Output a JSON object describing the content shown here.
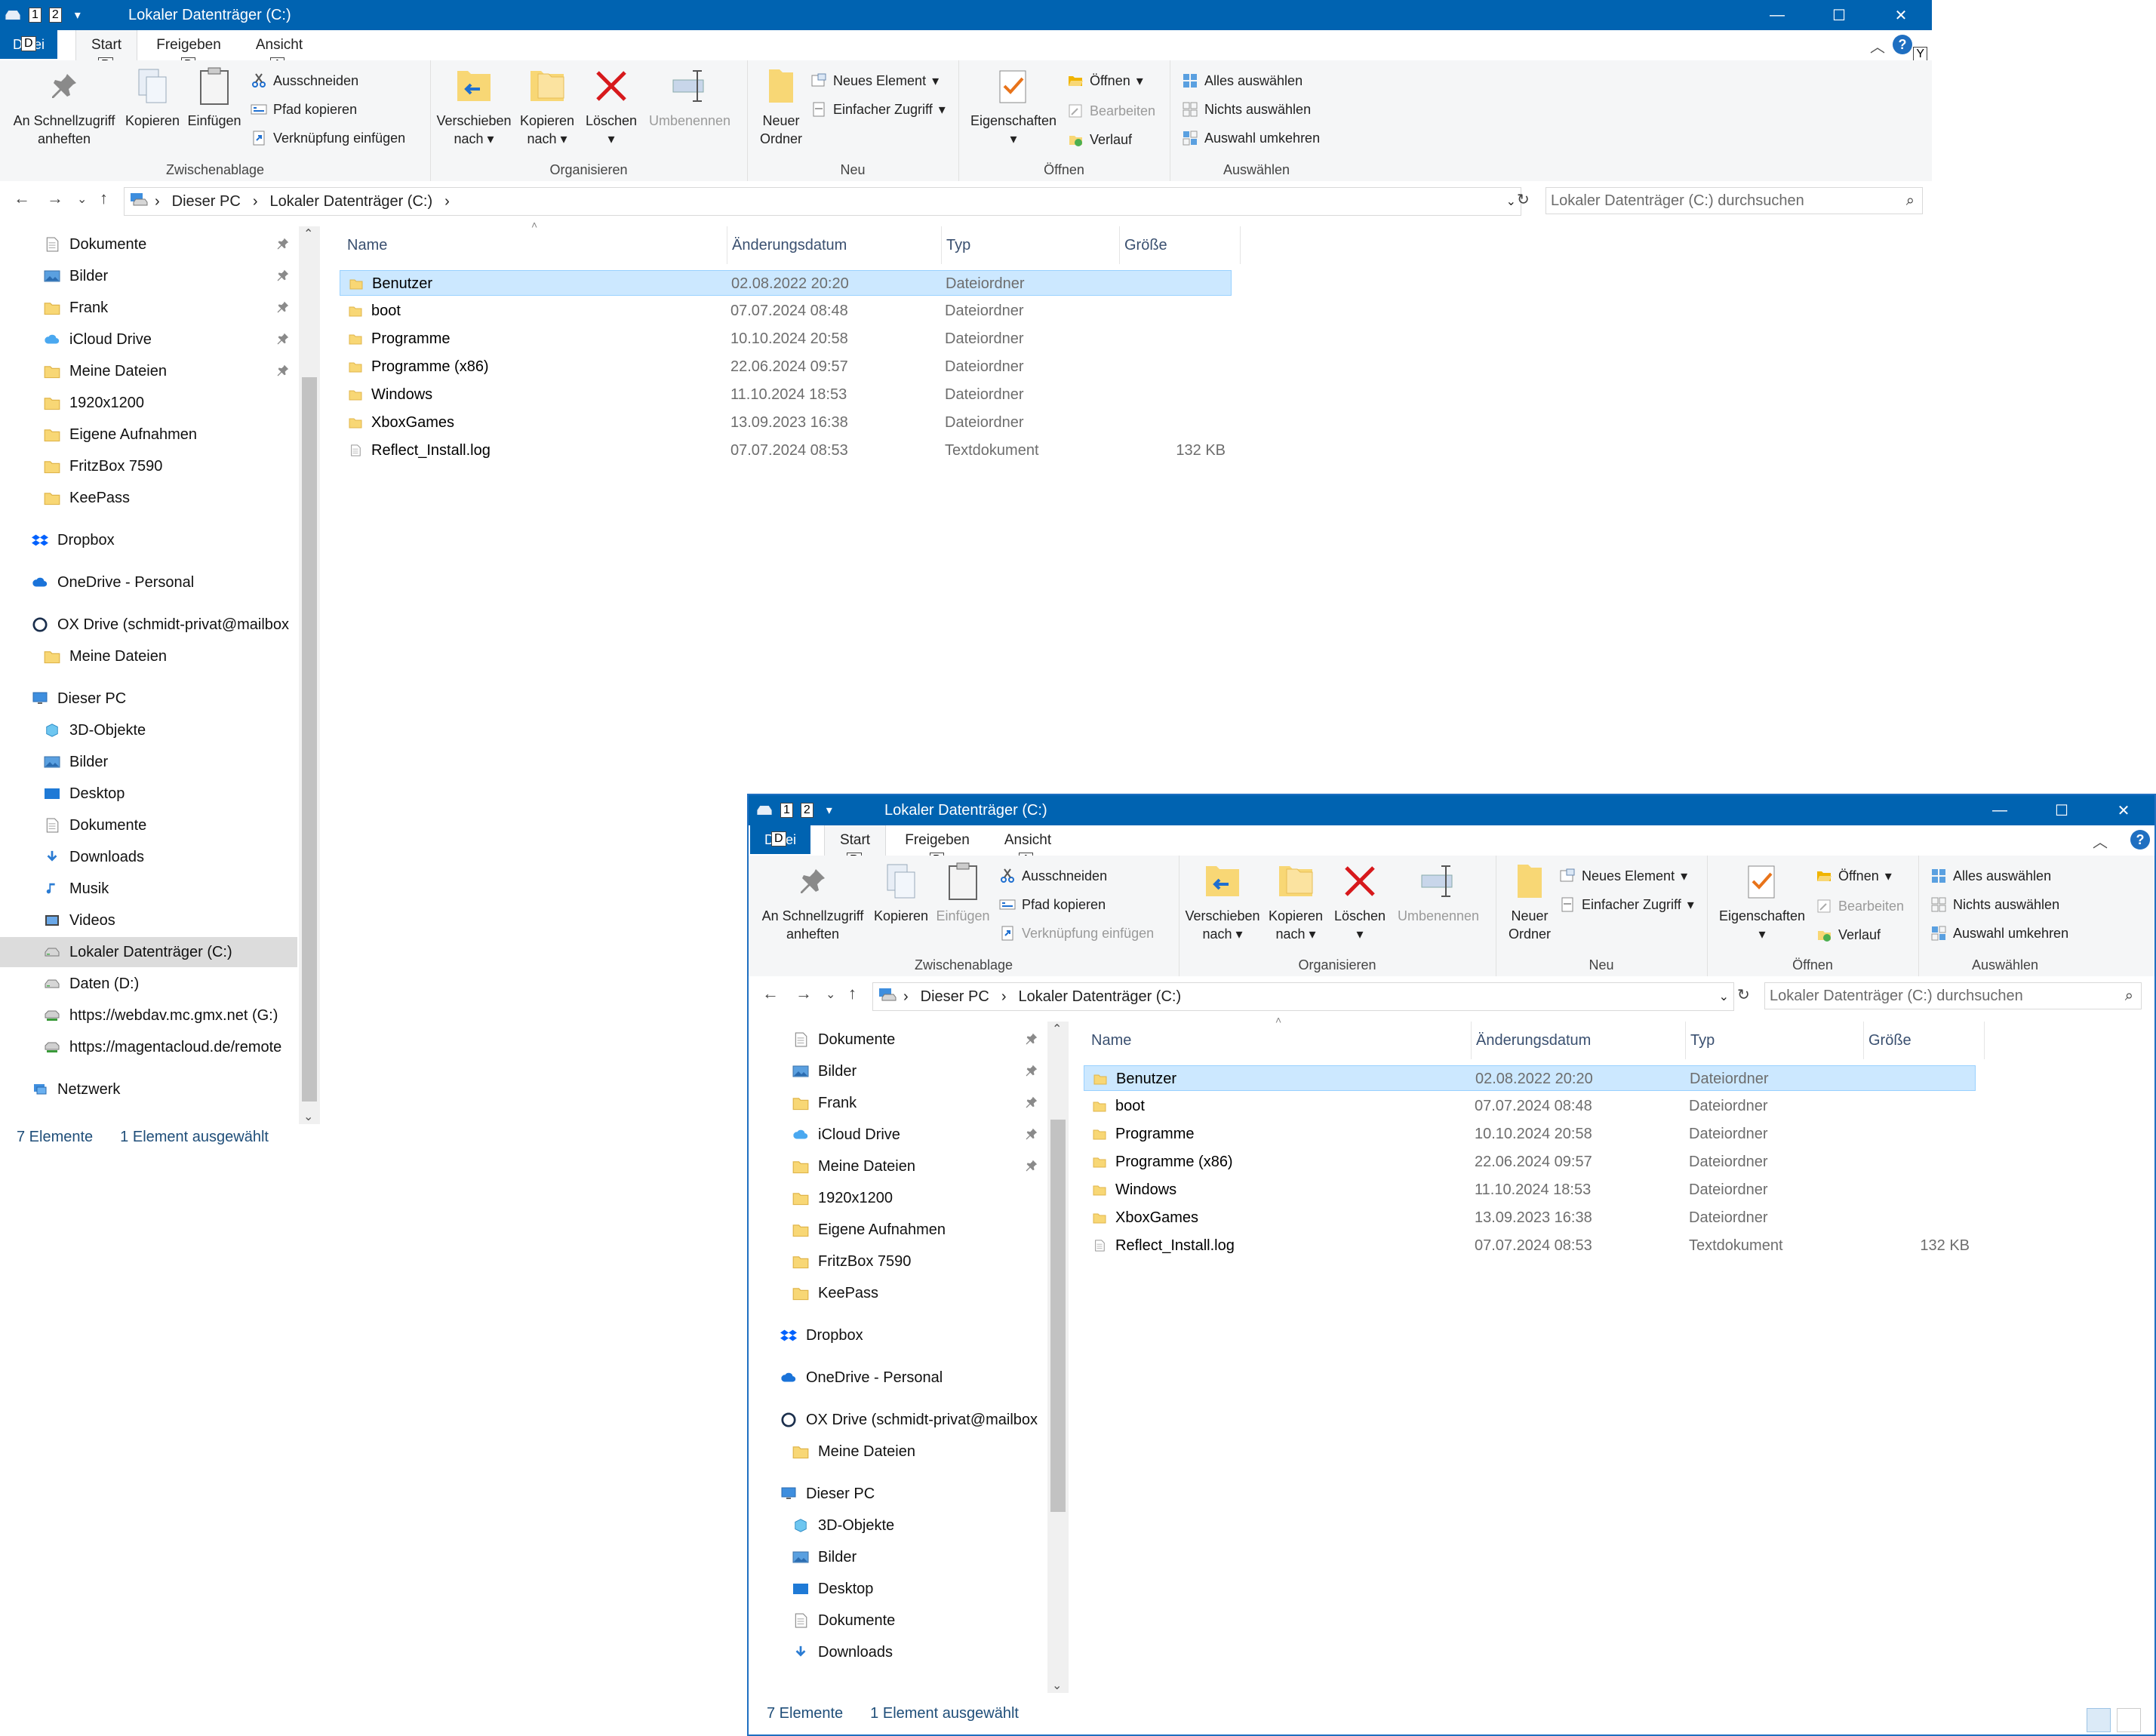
{
  "window": {
    "title": "Lokaler Datenträger (C:)",
    "qat_keytips": [
      "1",
      "2"
    ],
    "controls": {
      "minimize": "—",
      "maximize": "☐",
      "close": "✕"
    },
    "help_keytip": "Y"
  },
  "tabs": {
    "file": "Datei",
    "file_keytip": "D",
    "start": "Start",
    "start_keytip": "R",
    "share": "Freigeben",
    "share_keytip": "B",
    "view": "Ansicht",
    "view_keytip": "A"
  },
  "ribbon": {
    "clipboard": {
      "label": "Zwischenablage",
      "pin_line1": "An Schnellzugriff",
      "pin_line2": "anheften",
      "copy": "Kopieren",
      "paste": "Einfügen",
      "cut": "Ausschneiden",
      "copy_path": "Pfad kopieren",
      "paste_shortcut": "Verknüpfung einfügen"
    },
    "organize": {
      "label": "Organisieren",
      "move_line1": "Verschieben",
      "move_line2": "nach",
      "copyto_line1": "Kopieren",
      "copyto_line2": "nach",
      "delete": "Löschen",
      "rename": "Umbenennen"
    },
    "new": {
      "label": "Neu",
      "newfolder_line1": "Neuer",
      "newfolder_line2": "Ordner",
      "new_item": "Neues Element",
      "easy_access": "Einfacher Zugriff"
    },
    "open": {
      "label": "Öffnen",
      "properties": "Eigenschaften",
      "open": "Öffnen",
      "edit": "Bearbeiten",
      "history": "Verlauf"
    },
    "select": {
      "label": "Auswählen",
      "select_all": "Alles auswählen",
      "select_none": "Nichts auswählen",
      "invert": "Auswahl umkehren"
    }
  },
  "address": {
    "crumb1": "Dieser PC",
    "crumb2": "Lokaler Datenträger (C:)",
    "search_placeholder": "Lokaler Datenträger (C:) durchsuchen"
  },
  "nav": {
    "quick": [
      {
        "label": "Dokumente",
        "pinned": true
      },
      {
        "label": "Bilder",
        "pinned": true
      },
      {
        "label": "Frank",
        "pinned": true
      },
      {
        "label": "iCloud Drive",
        "pinned": true
      },
      {
        "label": "Meine Dateien",
        "pinned": true
      },
      {
        "label": "1920x1200",
        "pinned": false
      },
      {
        "label": "Eigene Aufnahmen",
        "pinned": false
      },
      {
        "label": "FritzBox 7590",
        "pinned": false
      },
      {
        "label": "KeePass",
        "pinned": false
      }
    ],
    "dropbox": "Dropbox",
    "onedrive": "OneDrive - Personal",
    "oxdrive": "OX Drive (schmidt-privat@mailbox",
    "oxdrive_child": "Meine Dateien",
    "thispc": "Dieser PC",
    "pc_children": [
      "3D-Objekte",
      "Bilder",
      "Desktop",
      "Dokumente",
      "Downloads",
      "Musik",
      "Videos",
      "Lokaler Datenträger (C:)",
      "Daten (D:)",
      "https://webdav.mc.gmx.net (G:)",
      "https://magentacloud.de/remote"
    ],
    "network": "Netzwerk"
  },
  "columns": {
    "name": "Name",
    "date": "Änderungsdatum",
    "type": "Typ",
    "size": "Größe"
  },
  "files": [
    {
      "name": "Benutzer",
      "date": "02.08.2022 20:20",
      "type": "Dateiordner",
      "size": "",
      "kind": "folder",
      "selected": true
    },
    {
      "name": "boot",
      "date": "07.07.2024 08:48",
      "type": "Dateiordner",
      "size": "",
      "kind": "folder",
      "selected": false
    },
    {
      "name": "Programme",
      "date": "10.10.2024 20:58",
      "type": "Dateiordner",
      "size": "",
      "kind": "folder",
      "selected": false
    },
    {
      "name": "Programme (x86)",
      "date": "22.06.2024 09:57",
      "type": "Dateiordner",
      "size": "",
      "kind": "folder",
      "selected": false
    },
    {
      "name": "Windows",
      "date": "11.10.2024 18:53",
      "type": "Dateiordner",
      "size": "",
      "kind": "folder",
      "selected": false
    },
    {
      "name": "XboxGames",
      "date": "13.09.2023 16:38",
      "type": "Dateiordner",
      "size": "",
      "kind": "folder",
      "selected": false
    },
    {
      "name": "Reflect_Install.log",
      "date": "07.07.2024 08:53",
      "type": "Textdokument",
      "size": "132 KB",
      "kind": "file",
      "selected": false
    }
  ],
  "status": {
    "count": "7 Elemente",
    "selected": "1 Element ausgewählt"
  },
  "colors": {
    "accent": "#0063b1",
    "selection": "#cce8ff",
    "folder": "#f8d775"
  }
}
